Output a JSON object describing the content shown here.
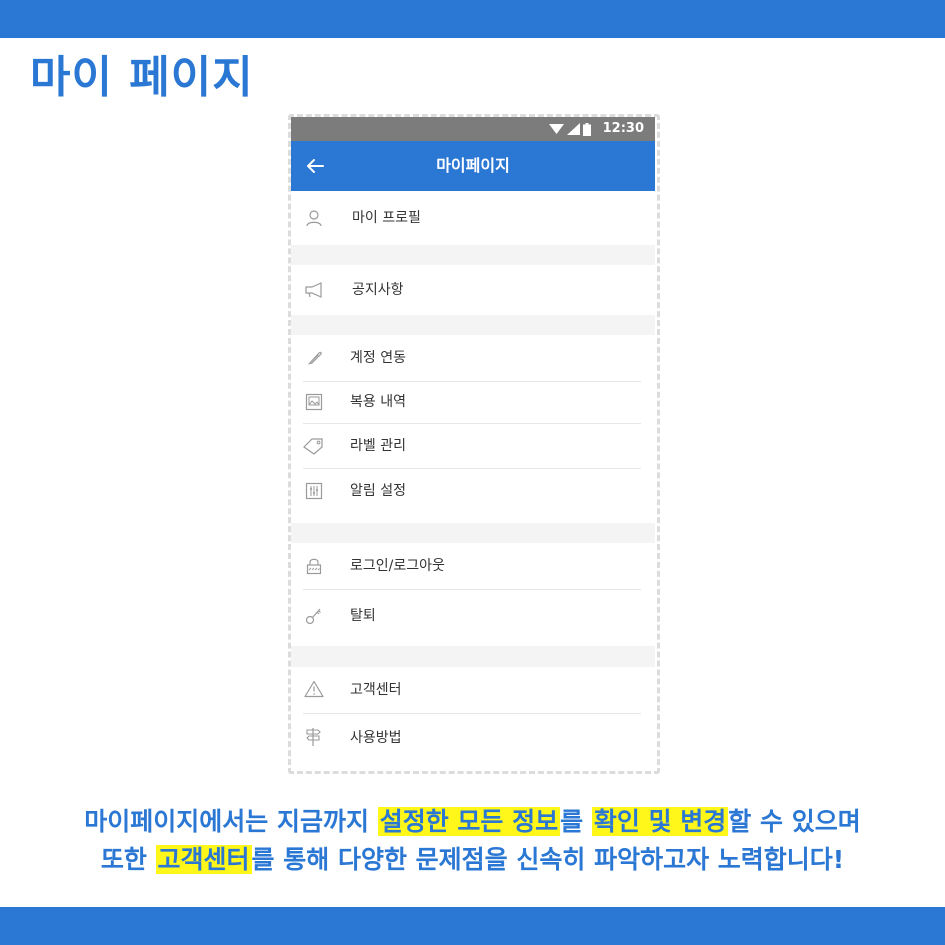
{
  "page": {
    "title": "마이 페이지"
  },
  "colors": {
    "accent": "#2b77d4",
    "highlight": "#fff71a",
    "statusbar": "#7c7c7c"
  },
  "phone": {
    "status_bar": {
      "time": "12:30",
      "icons": [
        "wifi-icon",
        "signal-icon",
        "battery-icon"
      ]
    },
    "app_bar": {
      "back_icon": "arrow-left-icon",
      "title": "마이페이지"
    },
    "menu": {
      "profile": {
        "icon": "user-icon",
        "label": "마이 프로필"
      },
      "notice": {
        "icon": "megaphone-icon",
        "label": "공지사항"
      },
      "account_link": {
        "icon": "paperclip-icon",
        "label": "계정 연동"
      },
      "restore_history": {
        "icon": "image-icon",
        "label": "복용 내역"
      },
      "label_manage": {
        "icon": "tag-icon",
        "label": "라벨 관리"
      },
      "notification_settings": {
        "icon": "sliders-icon",
        "label": "알림 설정"
      },
      "login_logout": {
        "icon": "lock-icon",
        "label": "로그인/로그아웃"
      },
      "withdraw": {
        "icon": "key-icon",
        "label": "탈퇴"
      },
      "customer_center": {
        "icon": "warning-icon",
        "label": "고객센터"
      },
      "how_to_use": {
        "icon": "signpost-icon",
        "label": "사용방법"
      }
    }
  },
  "description": {
    "line1": {
      "before": "마이페이지에서는 지금까지 ",
      "hl1": "설정한 모든 정보",
      "middle": "를 ",
      "hl2": "확인 및 변경",
      "after": "할 수 있으며"
    },
    "line2": {
      "before": "또한 ",
      "hl1": "고객센터",
      "after": "를 통해 다양한 문제점을 신속히 파악하고자 노력합니다!"
    }
  }
}
